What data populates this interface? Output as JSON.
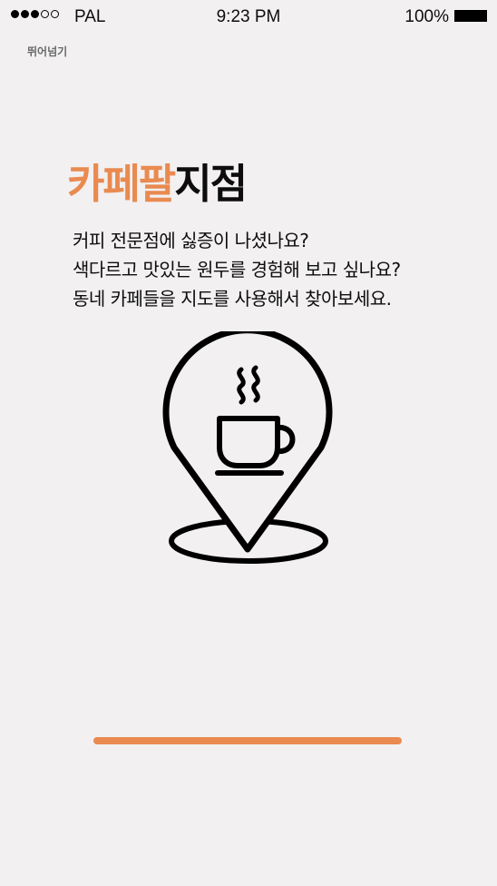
{
  "status_bar": {
    "signal_filled": 3,
    "signal_empty": 2,
    "carrier": "PAL",
    "time": "9:23 PM",
    "battery": "100%"
  },
  "skip_label": "뛰어넘기",
  "title": {
    "accent": "카페팔",
    "rest": "지점"
  },
  "description": [
    "커피 전문점에 싫증이 나셨나요?",
    "색다르고 맛있는 원두를 경험해 보고 싶나요?",
    "동네 카페들을 지도를 사용해서 찾아보세요."
  ],
  "illustration": {
    "icon": "map-pin-coffee-cup-icon"
  },
  "progress": {
    "value": 1.0
  },
  "colors": {
    "accent": "#e98a50",
    "background": "#f2f0f1",
    "text": "#0d0d0d"
  }
}
